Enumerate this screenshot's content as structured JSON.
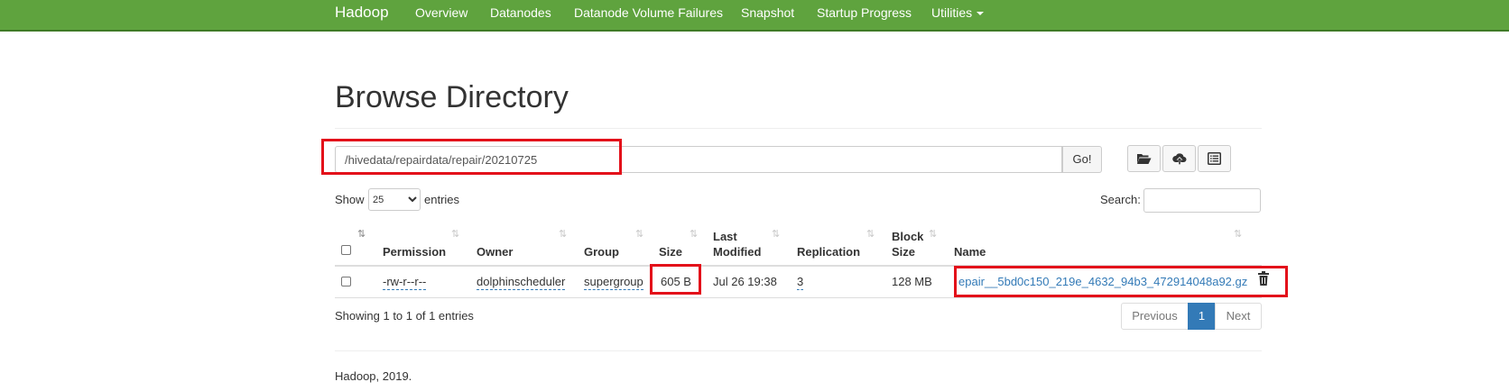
{
  "navbar": {
    "brand": "Hadoop",
    "links": [
      "Overview",
      "Datanodes",
      "Datanode Volume Failures",
      "Snapshot",
      "Startup Progress",
      "Utilities"
    ],
    "color": "#5fa33e"
  },
  "page": {
    "title": "Browse Directory"
  },
  "path_bar": {
    "value": "/hivedata/repairdata/repair/20210725",
    "go_label": "Go!",
    "icons": [
      "folder-open-icon",
      "cloud-upload-icon",
      "list-alt-icon"
    ]
  },
  "controls": {
    "show_label": "Show",
    "page_size": "25",
    "entries_label": "entries",
    "search_label": "Search:"
  },
  "table": {
    "headers": {
      "permission": "Permission",
      "owner": "Owner",
      "group": "Group",
      "size": "Size",
      "last_modified_1": "Last",
      "last_modified_2": "Modified",
      "replication": "Replication",
      "block_size_1": "Block",
      "block_size_2": "Size",
      "name": "Name"
    },
    "rows": [
      {
        "permission": "-rw-r--r--",
        "owner": "dolphinscheduler",
        "group": "supergroup",
        "size": "605 B",
        "last_modified": "Jul 26 19:38",
        "replication": "3",
        "block_size": "128 MB",
        "name": "epair__5bd0c150_219e_4632_94b3_472914048a92.gz"
      }
    ]
  },
  "pagination": {
    "info": "Showing 1 to 1 of 1 entries",
    "previous": "Previous",
    "current": "1",
    "next": "Next"
  },
  "footer": {
    "text": "Hadoop, 2019."
  },
  "highlight_color": "#e3101a"
}
